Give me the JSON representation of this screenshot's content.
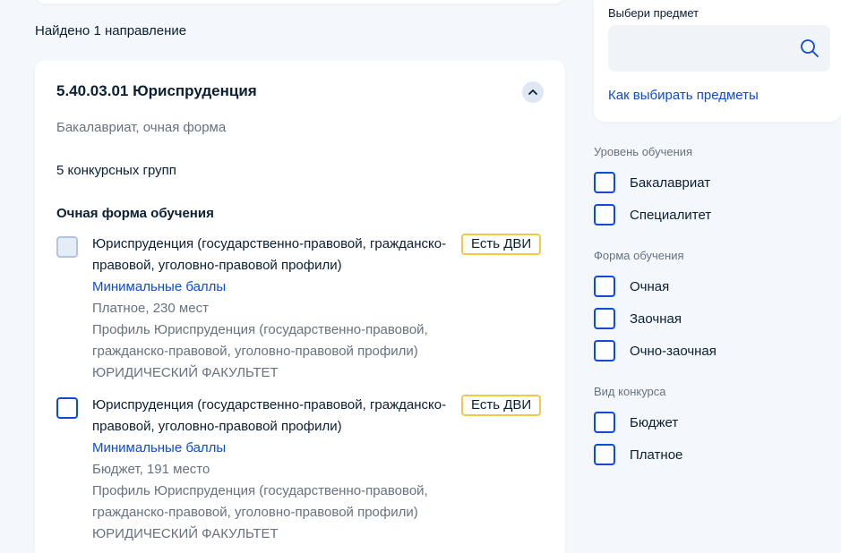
{
  "results": {
    "found_text": "Найдено 1 направление"
  },
  "direction": {
    "title": "5.40.03.01 Юриспруденция",
    "subtitle": "Бакалавриат, очная форма",
    "groups_count": "5 конкурсных групп",
    "form_heading": "Очная форма обучения",
    "programs": [
      {
        "name": "Юриспруденция (государственно-правовой, гражданско-правовой, уголовно-правовой профили)",
        "min_scores_link": "Минимальные баллы",
        "places": "Платное, 230 мест",
        "profile": "Профиль Юриспруденция (государственно-правовой, гражданско-правовой, уголовно-правовой профили)",
        "faculty": "ЮРИДИЧЕСКИЙ ФАКУЛЬТЕТ",
        "badge": "Есть ДВИ",
        "disabled": true
      },
      {
        "name": "Юриспруденция (государственно-правовой, гражданско-правовой, уголовно-правовой профили)",
        "min_scores_link": "Минимальные баллы",
        "places": "Бюджет, 191 место",
        "profile": "Профиль Юриспруденция (государственно-правовой, гражданско-правовой, уголовно-правовой профили)",
        "faculty": "ЮРИДИЧЕСКИЙ ФАКУЛЬТЕТ",
        "badge": "Есть ДВИ",
        "disabled": false
      }
    ]
  },
  "sidebar": {
    "subject_label": "Выбери предмет",
    "subject_value": "",
    "how_to_choose_link": "Как выбирать предметы",
    "filters": {
      "level": {
        "heading": "Уровень обучения",
        "options": [
          "Бакалавриат",
          "Специалитет"
        ]
      },
      "form": {
        "heading": "Форма обучения",
        "options": [
          "Очная",
          "Заочная",
          "Очно-заочная"
        ]
      },
      "contest": {
        "heading": "Вид конкурса",
        "options": [
          "Бюджет",
          "Платное"
        ]
      }
    }
  },
  "colors": {
    "accent": "#0d4cd3",
    "badge_border": "#f0c946",
    "muted_text": "#66727f",
    "background": "#f4f7fb"
  }
}
